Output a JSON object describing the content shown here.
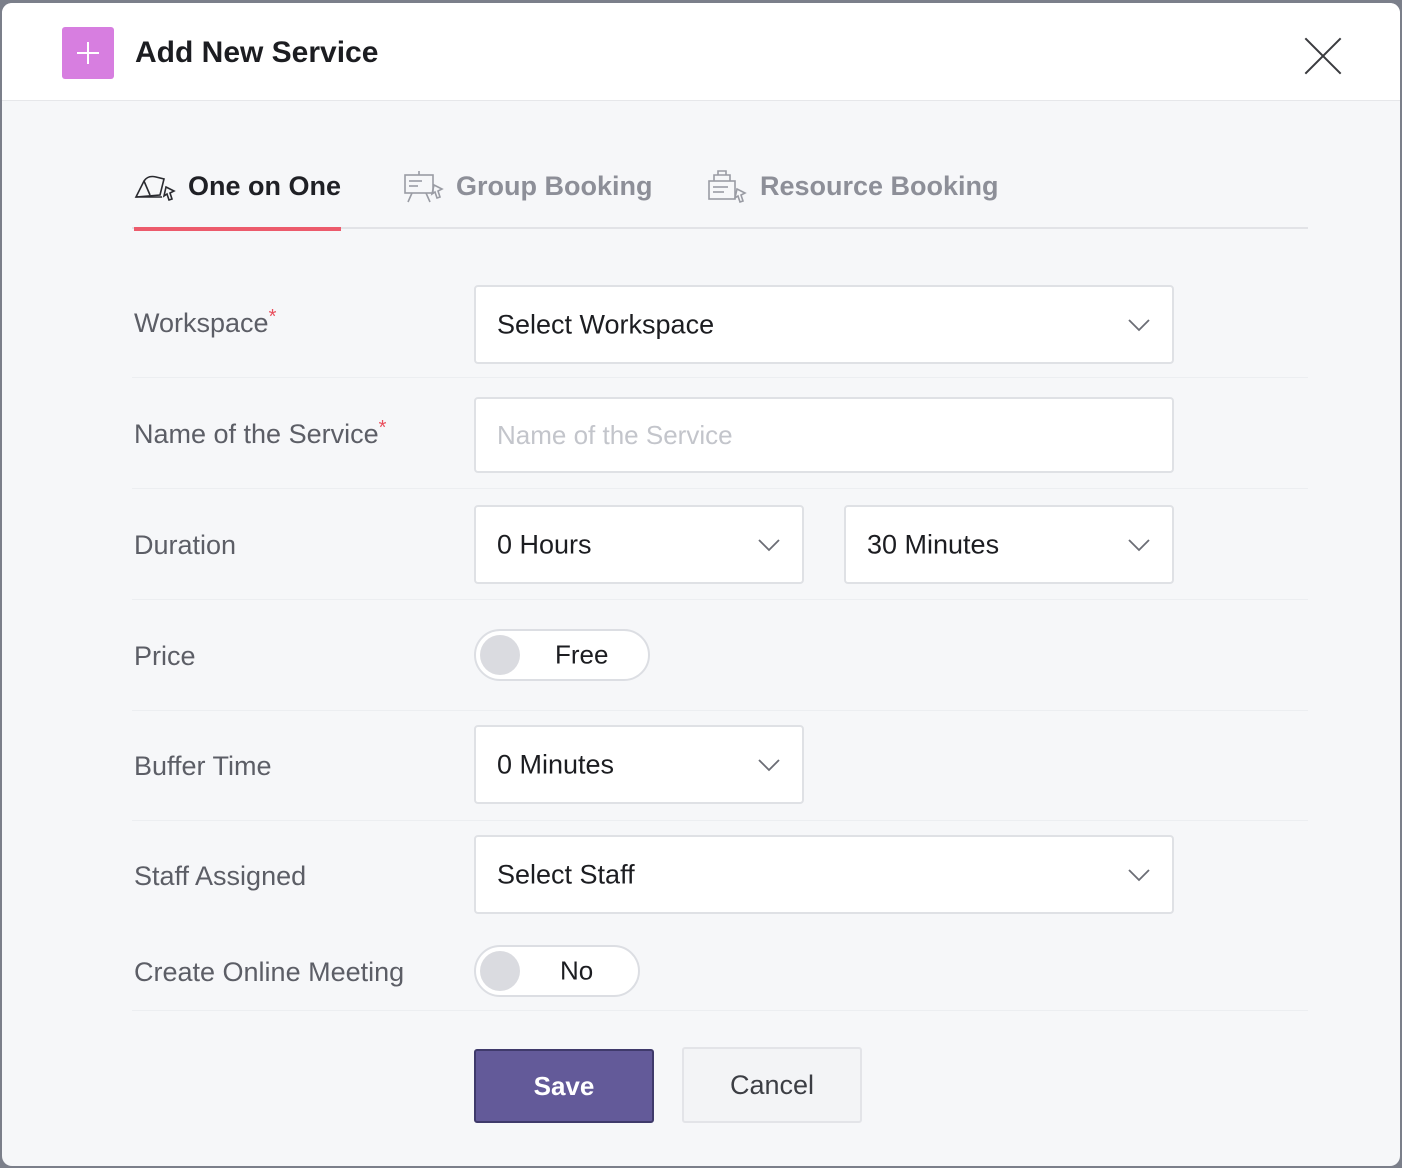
{
  "modal": {
    "title": "Add New Service",
    "header_icon": "plus-icon",
    "close_icon": "close-icon",
    "accent_color": "#d77ee0"
  },
  "tabs": [
    {
      "label": "One on One",
      "icon": "one-on-one-icon",
      "active": true
    },
    {
      "label": "Group Booking",
      "icon": "group-booking-icon",
      "active": false
    },
    {
      "label": "Resource Booking",
      "icon": "resource-booking-icon",
      "active": false
    }
  ],
  "form": {
    "workspace": {
      "label": "Workspace",
      "required_mark": "*",
      "value": "Select Workspace"
    },
    "service_name": {
      "label": "Name of the Service",
      "required_mark": "*",
      "placeholder": "Name of the Service",
      "value": ""
    },
    "duration": {
      "label": "Duration",
      "hours_value": "0 Hours",
      "minutes_value": "30 Minutes"
    },
    "price": {
      "label": "Price",
      "toggle_text": "Free",
      "enabled": false
    },
    "buffer_time": {
      "label": "Buffer Time",
      "value": "0 Minutes"
    },
    "staff": {
      "label": "Staff Assigned",
      "value": "Select Staff"
    },
    "online_meeting": {
      "label": "Create Online Meeting",
      "toggle_text": "No",
      "enabled": false
    }
  },
  "actions": {
    "save_label": "Save",
    "cancel_label": "Cancel",
    "save_color": "#635a99"
  },
  "active_tab_underline_color": "#ec5b6c"
}
